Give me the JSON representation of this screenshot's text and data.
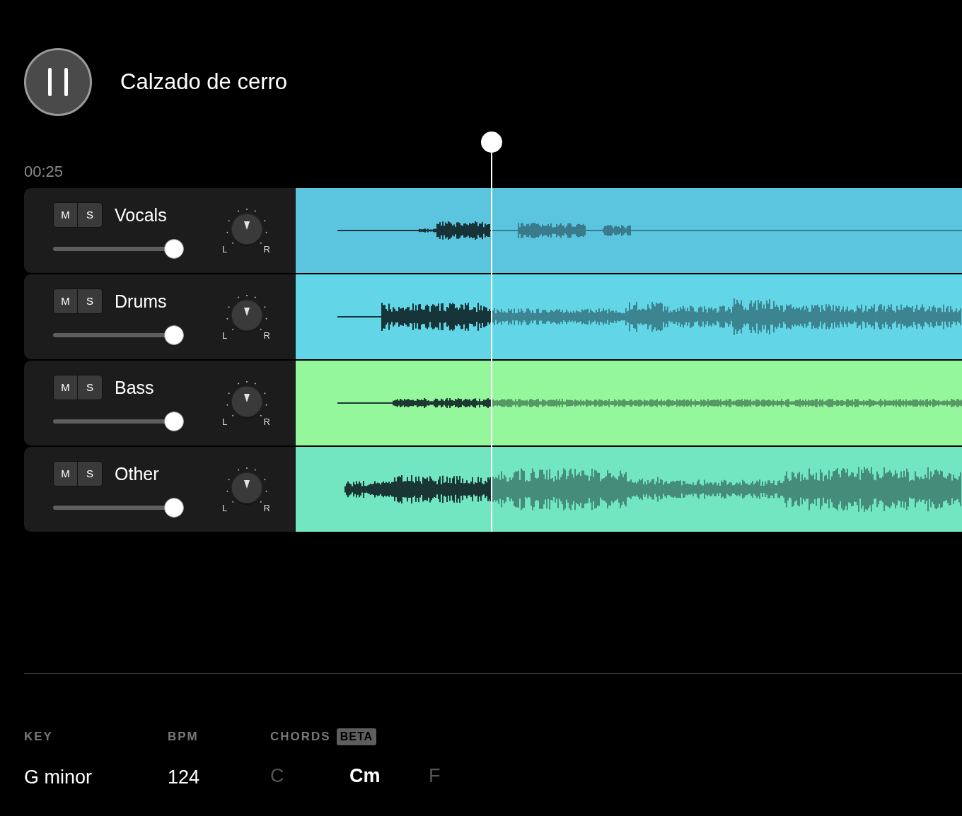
{
  "player": {
    "playing": true,
    "title": "Calzado de cerro",
    "time": "00:25"
  },
  "playhead": {
    "level": 0.294
  },
  "tracks": [
    {
      "mute": "M",
      "solo": "S",
      "muted": false,
      "soloed": false,
      "name": "Vocals",
      "volume": {
        "level": 0.93
      },
      "pan_left": "L",
      "pan_right": "R",
      "color": "#5bc5e0"
    },
    {
      "mute": "M",
      "solo": "S",
      "muted": false,
      "soloed": false,
      "name": "Drums",
      "volume": {
        "level": 0.93
      },
      "pan_left": "L",
      "pan_right": "R",
      "color": "#62d5e6"
    },
    {
      "mute": "M",
      "solo": "S",
      "muted": false,
      "soloed": false,
      "name": "Bass",
      "volume": {
        "level": 0.93
      },
      "pan_left": "L",
      "pan_right": "R",
      "color": "#94f79c"
    },
    {
      "mute": "M",
      "solo": "S",
      "muted": false,
      "soloed": false,
      "name": "Other",
      "volume": {
        "level": 0.93
      },
      "pan_left": "L",
      "pan_right": "R",
      "color": "#72e6c0"
    }
  ],
  "info": {
    "key_label": "KEY",
    "key": "G minor",
    "bpm_label": "BPM",
    "bpm": "124",
    "chords_label": "CHORDS",
    "chords_badge": "BETA",
    "chords": [
      {
        "name": "C",
        "selected": false
      },
      {
        "name": "Cm",
        "selected": true
      },
      {
        "name": "F",
        "selected": false
      }
    ]
  }
}
